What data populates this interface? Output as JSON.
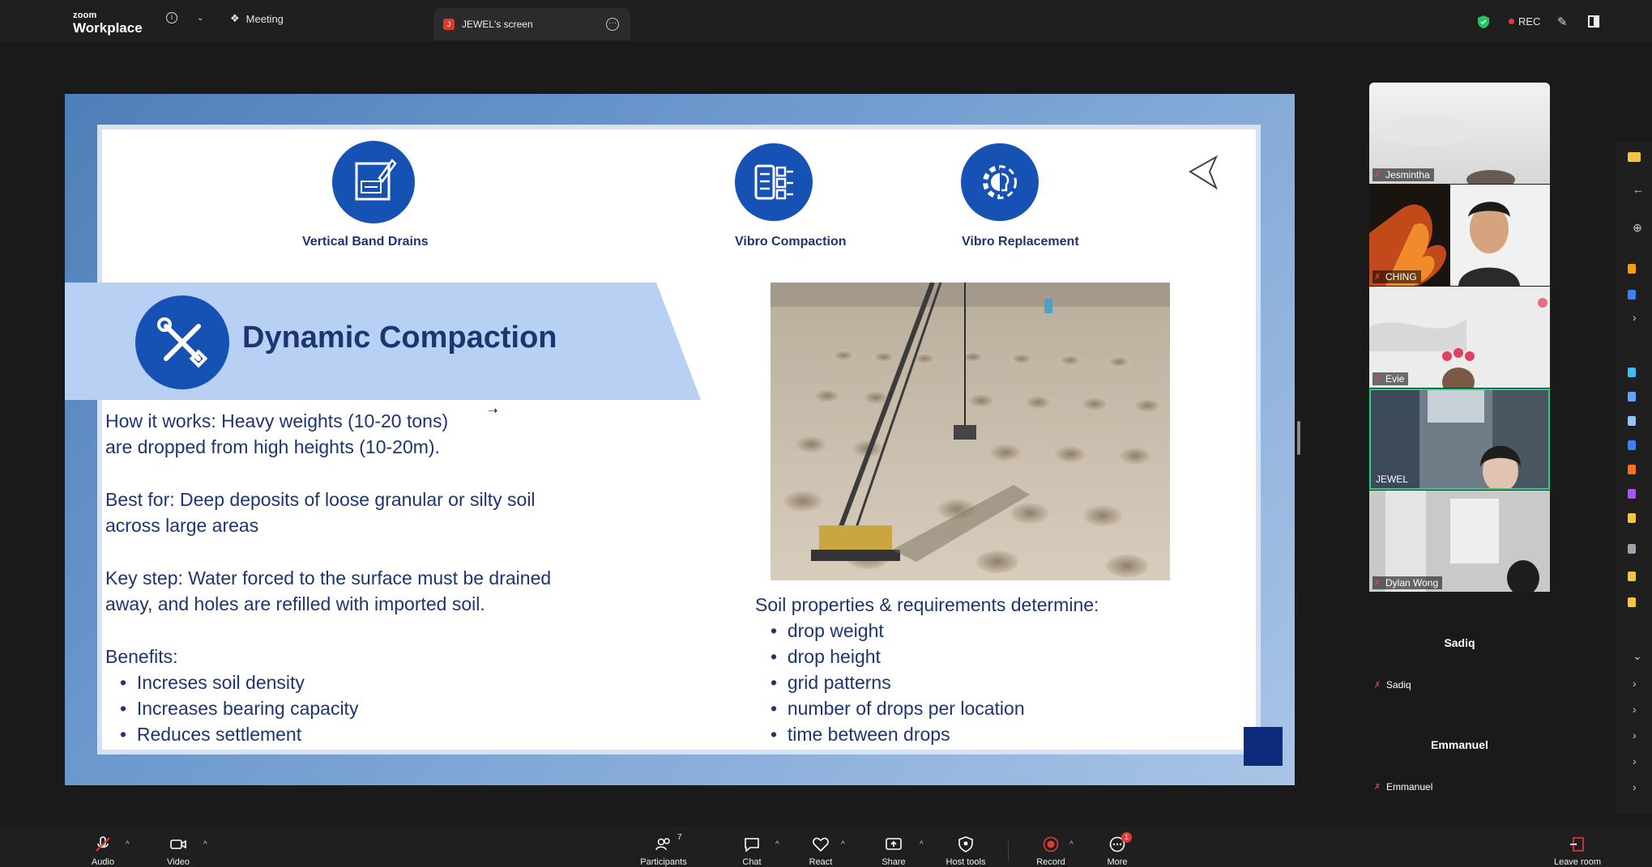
{
  "topbar": {
    "brand_top": "zoom",
    "brand_bottom": "Workplace",
    "meeting_label": "Meeting",
    "screen_tab_initial": "J",
    "screen_tab_label": "JEWEL's screen",
    "rec_label": "REC"
  },
  "slide": {
    "icons": [
      {
        "caption": "Vertical Band Drains"
      },
      {
        "caption": "Vibro Compaction"
      },
      {
        "caption": "Vibro Replacement"
      }
    ],
    "title": "Dynamic Compaction",
    "left_text": {
      "how_1": "How it works: Heavy weights (10-20 tons)",
      "how_2": "are dropped from high heights (10-20m).",
      "best_1": "Best for: Deep deposits of loose granular or silty soil",
      "best_2": "across large areas",
      "key_1": "Key step: Water forced to the surface must be drained",
      "key_2": "away, and holes are refilled with imported soil.",
      "benefits_label": "Benefits:",
      "benefits": [
        "Increses soil density",
        "Increases bearing capacity",
        "Reduces settlement"
      ]
    },
    "right_text": {
      "heading": "Soil properties & requirements determine:",
      "items": [
        "drop weight",
        "drop height",
        "grid patterns",
        "number of drops per location",
        "time between drops"
      ]
    },
    "colors": {
      "navy": "#1d3571",
      "circle_blue": "#1651b4",
      "banner": "#b8d0f4"
    }
  },
  "participants_gallery": [
    {
      "name": "Jesmintha",
      "muted": true
    },
    {
      "name": "CHING",
      "muted": true
    },
    {
      "name": "Evie",
      "muted": true
    },
    {
      "name": "JEWEL",
      "muted": false,
      "active_speaker": true
    },
    {
      "name": "Dylan Wong",
      "muted": true
    }
  ],
  "avatar_only": [
    {
      "title": "Sadiq",
      "label": "Sadiq"
    },
    {
      "title": "Emmanuel",
      "label": "Emmanuel"
    }
  ],
  "toolbar": {
    "audio": "Audio",
    "video": "Video",
    "participants": "Participants",
    "participants_count": "7",
    "chat": "Chat",
    "react": "React",
    "share": "Share",
    "host_tools": "Host tools",
    "record": "Record",
    "more": "More",
    "more_badge": "1",
    "leave": "Leave room"
  }
}
